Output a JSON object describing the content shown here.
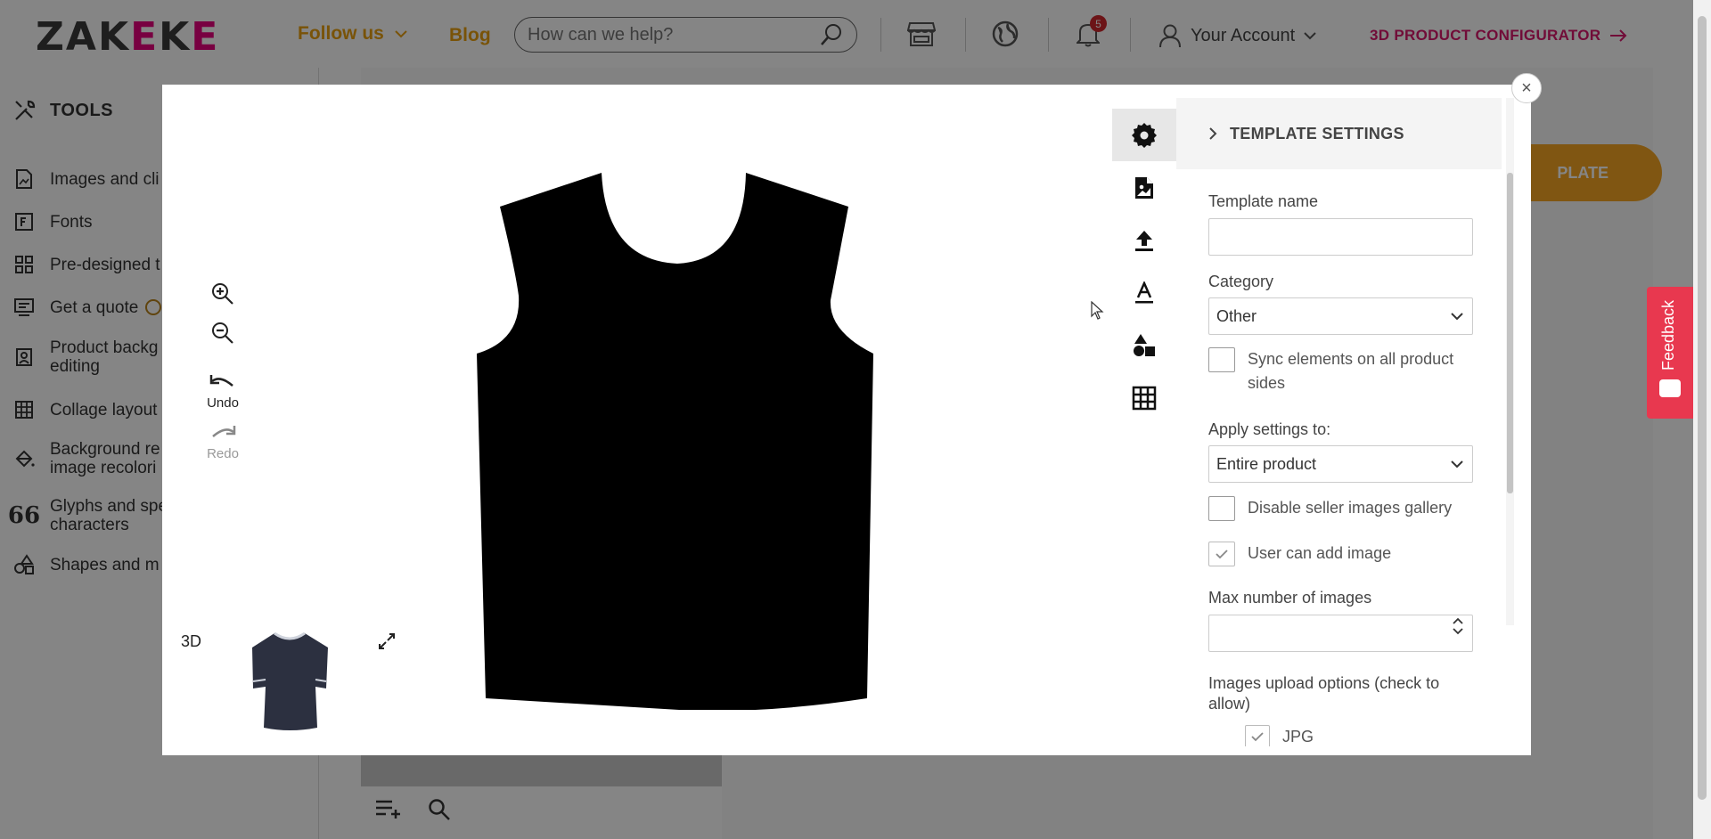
{
  "header": {
    "logo_text": "ZAKEKE",
    "follow_us": "Follow us",
    "blog": "Blog",
    "search_placeholder": "How can we help?",
    "notification_count": "5",
    "account": "Your Account",
    "configurator": "3D PRODUCT CONFIGURATOR"
  },
  "sidebar": {
    "title": "TOOLS",
    "items": [
      {
        "label": "Images and cli",
        "icon": "image-doc-icon"
      },
      {
        "label": "Fonts",
        "icon": "font-icon"
      },
      {
        "label": "Pre-designed t",
        "icon": "grid-icon"
      },
      {
        "label": "Get a quote",
        "icon": "quote-icon"
      },
      {
        "label": "Product backg editing",
        "icon": "portrait-icon"
      },
      {
        "label": "Collage layout",
        "icon": "table-icon"
      },
      {
        "label": "Background re image recolori",
        "icon": "paint-bucket-icon"
      },
      {
        "label": "Glyphs and spe characters",
        "icon": "quote-marks-icon"
      },
      {
        "label": "Shapes and m",
        "icon": "shapes-icon"
      }
    ]
  },
  "background": {
    "orange_button": "PLATE"
  },
  "feedback": "Feedback",
  "modal": {
    "close": "×",
    "undo": "Undo",
    "redo": "Redo",
    "label_3d": "3D",
    "settings": {
      "title": "TEMPLATE SETTINGS",
      "template_name_label": "Template name",
      "template_name_value": "",
      "category_label": "Category",
      "category_value": "Other",
      "sync_label": "Sync elements on all product sides",
      "apply_label": "Apply settings to:",
      "apply_value": "Entire product",
      "disable_gallery_label": "Disable seller images gallery",
      "user_add_image_label": "User can add image",
      "max_images_label": "Max number of images",
      "max_images_value": "",
      "upload_options_label": "Images upload options (check to allow)",
      "jpg_label": "JPG"
    }
  },
  "colors": {
    "accent_orange": "#e8a010",
    "accent_pink": "#d8186c",
    "feedback_red": "#e8384f",
    "badge_red": "#d0272c"
  }
}
